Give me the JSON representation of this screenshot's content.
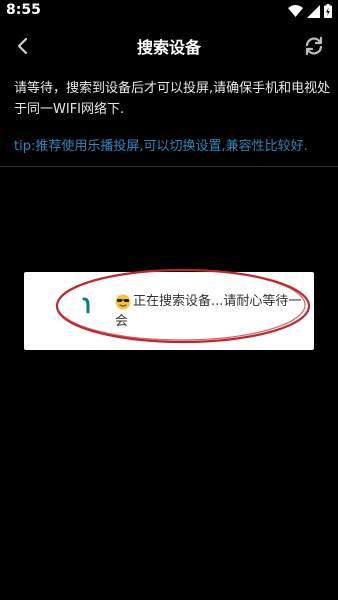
{
  "status_bar": {
    "time": "8:55",
    "icons": [
      "wifi-icon",
      "signal-icon",
      "battery-icon"
    ]
  },
  "title_bar": {
    "title": "搜索设备",
    "back_icon": "chevron-left-icon",
    "refresh_icon": "refresh-icon"
  },
  "content": {
    "instruction": "请等待，搜索到设备后才可以投屏,请确保手机和电视处于同一WIFI网络下.",
    "tip": "tip:推荐使用乐播投屏,可以切换设置,兼容性比较好."
  },
  "dialog": {
    "message": "正在搜索设备...请耐心等待一会",
    "emoji_icon": "sunglasses-emoji-icon",
    "spinner_icon": "loading-spinner-icon"
  },
  "colors": {
    "background": "#000000",
    "tip_text": "#2a87b8",
    "annotation": "#c0262d",
    "spinner": "#0f7a6e"
  }
}
